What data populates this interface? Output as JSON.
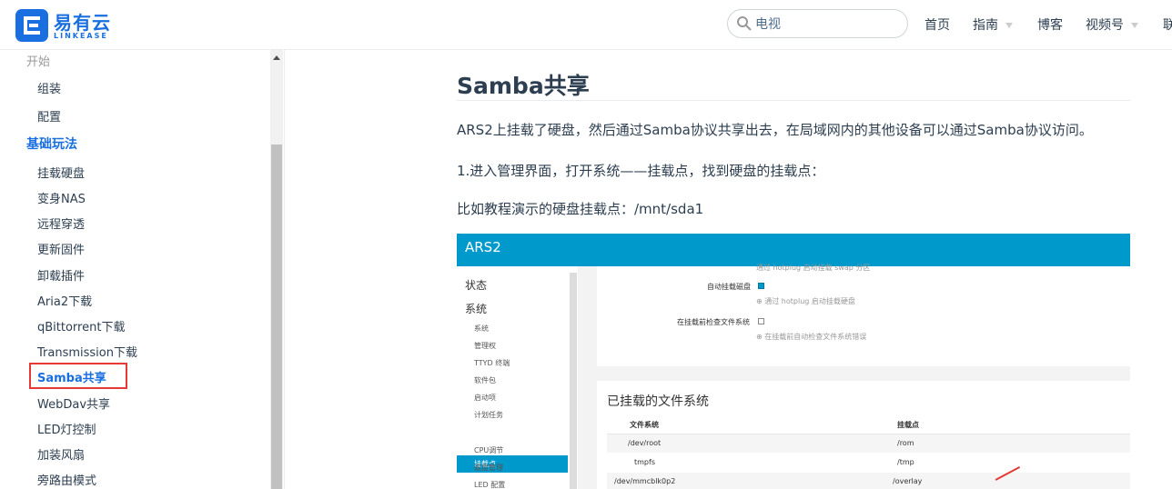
{
  "header": {
    "logo_cn": "易有云",
    "logo_en": "LINKEASE",
    "search": {
      "value": "电视"
    },
    "nav": [
      {
        "label": "首页"
      },
      {
        "label": "指南",
        "dropdown": true
      },
      {
        "label": "博客"
      },
      {
        "label": "视频号",
        "dropdown": true
      },
      {
        "label": "联"
      }
    ]
  },
  "sidebar": {
    "start_group": "开始",
    "start_items": [
      "组装",
      "配置"
    ],
    "basic_group": "基础玩法",
    "basic_items": [
      "挂载硬盘",
      "变身NAS",
      "远程穿透",
      "更新固件",
      "卸载插件",
      "Aria2下载",
      "qBittorrent下载",
      "Transmission下载",
      "Samba共享",
      "WebDav共享",
      "LED灯控制",
      "加装风扇",
      "旁路由模式"
    ],
    "current_item": "Samba共享"
  },
  "content": {
    "title": "Samba共享",
    "paragraphs": [
      "ARS2上挂载了硬盘，然后通过Samba协议共享出去，在局域网内的其他设备可以通过Samba协议访问。",
      "1.进入管理界面，打开系统——挂载点，找到硬盘的挂载点：",
      "比如教程演示的硬盘挂载点：/mnt/sda1"
    ]
  },
  "screenshot": {
    "brand": "ARS2",
    "menu": [
      "状态",
      "系统"
    ],
    "submenu": [
      "系统",
      "管理权",
      "TTYD 终端",
      "软件包",
      "启动项",
      "计划任务",
      "挂载点",
      "CPU调节",
      "磁盘管理",
      "LED 配置"
    ],
    "active_sub": "挂载点",
    "options": [
      {
        "label": "自动挂载磁盘",
        "checked": true,
        "hint": "通过 hotplug 启动挂载硬盘"
      },
      {
        "label": "在挂载前检查文件系统",
        "checked": false,
        "hint": "在挂载前自动检查文件系统错误"
      }
    ],
    "top_hint": "通过 hotplug 启动挂载 swap 分区",
    "panel_title": "已挂载的文件系统",
    "table": {
      "headers": [
        "文件系统",
        "挂载点"
      ],
      "rows": [
        [
          "/dev/root",
          "/rom"
        ],
        [
          "tmpfs",
          "/tmp"
        ],
        [
          "/dev/mmcblk0p2",
          "/overlay"
        ]
      ]
    }
  },
  "colors": {
    "accent": "#1a6fe0",
    "luci_header": "#0099cc",
    "highlight_border": "#e53935"
  }
}
